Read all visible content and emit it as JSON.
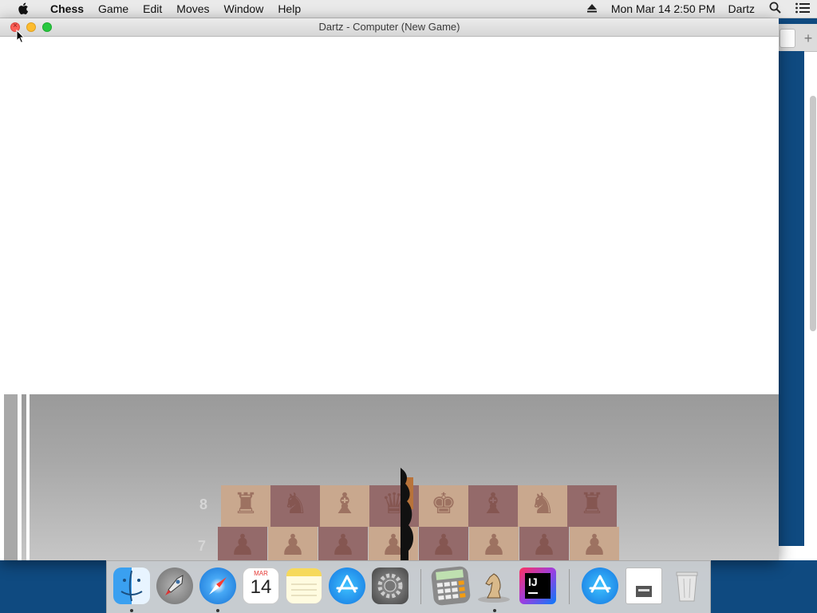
{
  "menubar": {
    "app_name": "Chess",
    "items": [
      "Game",
      "Edit",
      "Moves",
      "Window",
      "Help"
    ],
    "clock": "Mon Mar 14  2:50 PM",
    "user": "Dartz"
  },
  "window": {
    "title": "Dartz - Computer   (New Game)"
  },
  "board": {
    "rank_labels": [
      "8",
      "7"
    ]
  },
  "dock": {
    "apps": [
      "Finder",
      "Launchpad",
      "Safari",
      "Calendar",
      "Notes",
      "App Store",
      "System Preferences",
      "Calculator",
      "Chess",
      "IntelliJ IDEA",
      "App Store Downloads",
      "Disk Utility",
      "Trash"
    ],
    "calendar_month": "MAR",
    "calendar_day": "14",
    "intellij_label": "IJ"
  },
  "colors": {
    "close": "#fc5f57",
    "minimize": "#fdbc2e",
    "maximize": "#28c840",
    "desktop": "#0f4a80"
  }
}
